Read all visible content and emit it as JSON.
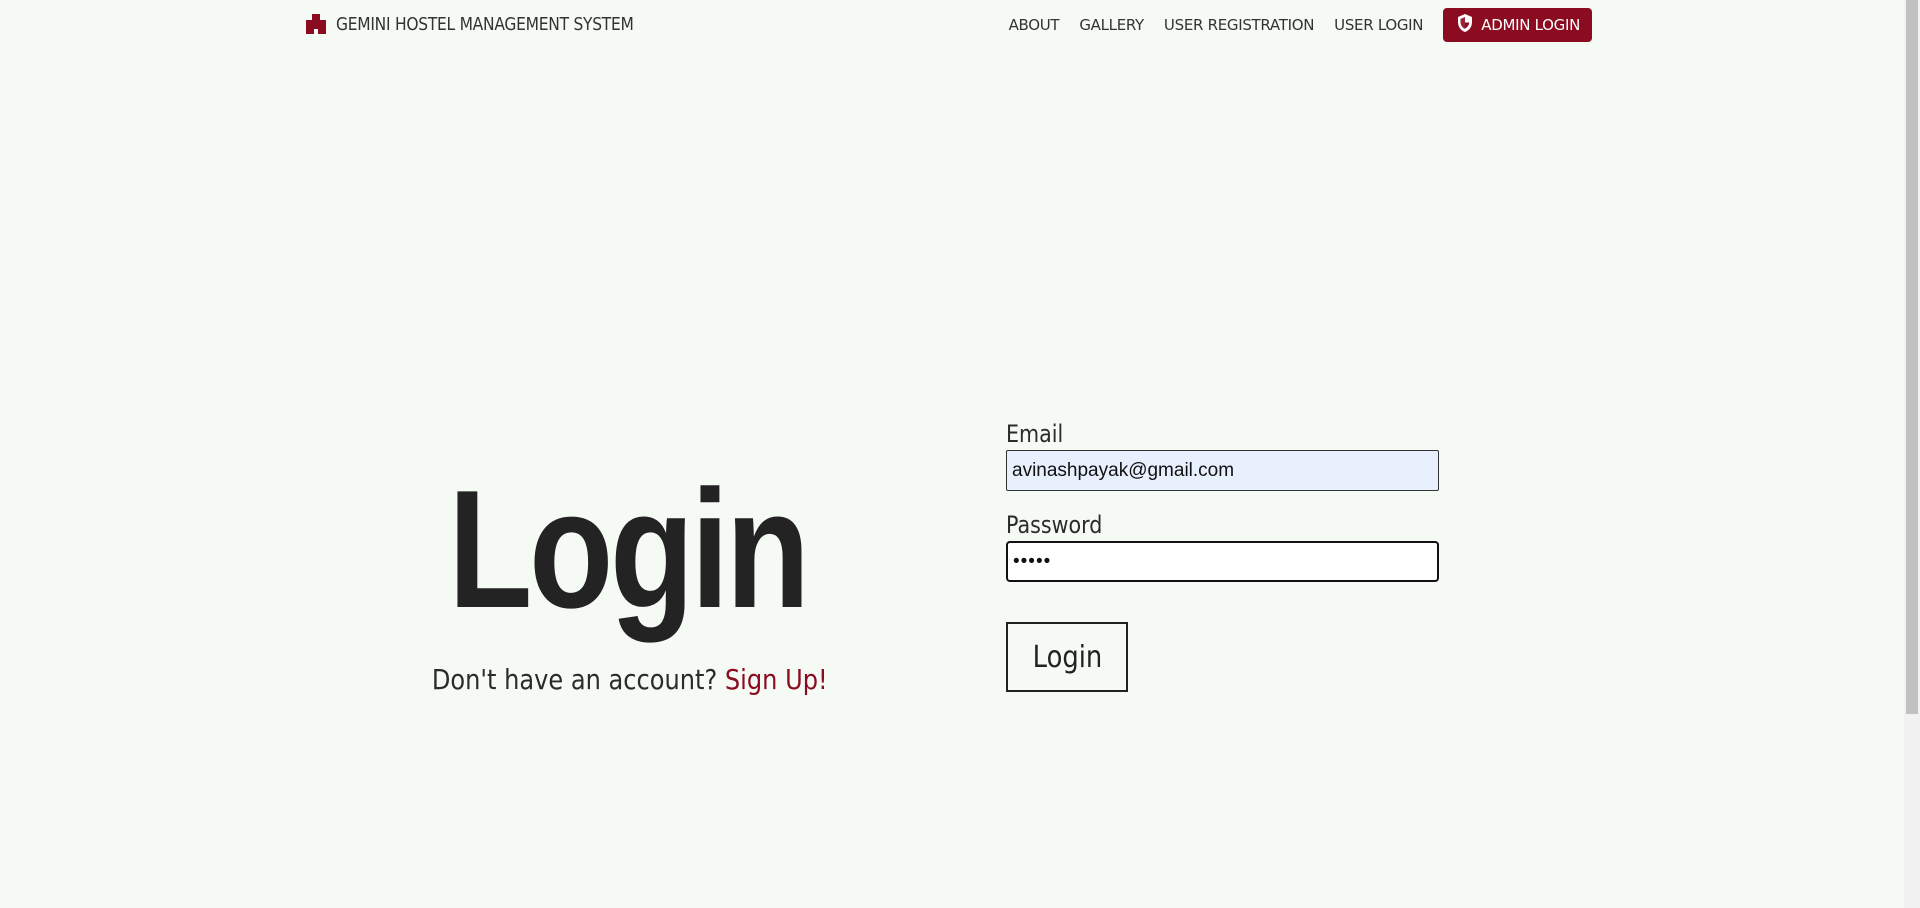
{
  "navbar": {
    "brand": "GEMINI HOSTEL MANAGEMENT SYSTEM",
    "brand_icon": "building-icon",
    "links": [
      "ABOUT",
      "GALLERY",
      "USER REGISTRATION",
      "USER LOGIN"
    ],
    "admin_button": "ADMIN LOGIN",
    "admin_icon": "shield-icon"
  },
  "hero": {
    "title": "Login",
    "signup_prompt": "Don't have an account?",
    "signup_link": "Sign Up!"
  },
  "form": {
    "email_label": "Email",
    "email_value": "avinashpayak@gmail.com",
    "password_label": "Password",
    "password_value": "•••••",
    "submit_label": "Login"
  },
  "colors": {
    "accent": "#8b0c20",
    "background": "#f5faf5",
    "autofill": "#e8effd"
  }
}
